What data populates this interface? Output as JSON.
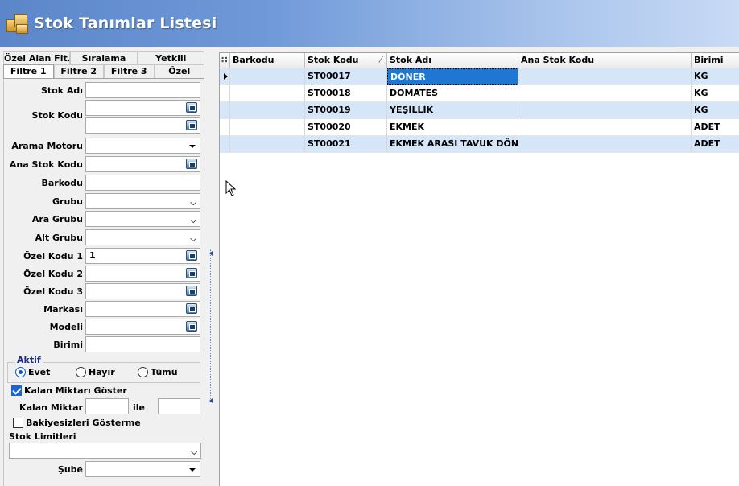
{
  "window": {
    "title": "Stok Tanımlar Listesi"
  },
  "tabs": {
    "row1": [
      "Özel Alan Flt.",
      "Sıralama",
      "Yetkili"
    ],
    "row2": [
      "Filtre 1",
      "Filtre 2",
      "Filtre 3",
      "Özel"
    ],
    "active": "Filtre 1"
  },
  "filter": {
    "labels": {
      "stok_adi": "Stok Adı",
      "stok_kodu": "Stok Kodu",
      "arama_motoru": "Arama Motoru",
      "ana_stok_kodu": "Ana Stok Kodu",
      "barkodu": "Barkodu",
      "grubu": "Grubu",
      "ara_grubu": "Ara Grubu",
      "alt_grubu": "Alt Grubu",
      "ozel_kodu_1": "Özel Kodu 1",
      "ozel_kodu_2": "Özel Kodu 2",
      "ozel_kodu_3": "Özel Kodu 3",
      "markasi": "Markası",
      "modeli": "Modeli",
      "birimi": "Birimi",
      "kalan_miktar": "Kalan Miktar",
      "ile": "ile",
      "stok_limitleri": "Stok Limitleri",
      "sube": "Şube"
    },
    "values": {
      "ozel_kodu_1": "1"
    },
    "aktif": {
      "title": "Aktif",
      "options": [
        "Evet",
        "Hayır",
        "Tümü"
      ],
      "selected": "Evet"
    },
    "checkboxes": {
      "kalan_miktari_goster": {
        "label": "Kalan Miktarı Göster",
        "checked": true
      },
      "bakiyesizleri_gosterme": {
        "label": "Bakiyesizleri Gösterme",
        "checked": false
      }
    }
  },
  "grid": {
    "columns": [
      "Barkodu",
      "Stok Kodu",
      "Stok Adı",
      "Ana Stok Kodu",
      "Birimi"
    ],
    "rows": [
      {
        "barkodu": "",
        "stok_kodu": "ST00017",
        "stok_adi": "DÖNER",
        "ana_stok_kodu": "",
        "birimi": "KG"
      },
      {
        "barkodu": "",
        "stok_kodu": "ST00018",
        "stok_adi": "DOMATES",
        "ana_stok_kodu": "",
        "birimi": "KG"
      },
      {
        "barkodu": "",
        "stok_kodu": "ST00019",
        "stok_adi": "YEŞİLLİK",
        "ana_stok_kodu": "",
        "birimi": "KG"
      },
      {
        "barkodu": "",
        "stok_kodu": "ST00020",
        "stok_adi": "EKMEK",
        "ana_stok_kodu": "",
        "birimi": "ADET"
      },
      {
        "barkodu": "",
        "stok_kodu": "ST00021",
        "stok_adi": "EKMEK ARASI TAVUK DÖNER",
        "ana_stok_kodu": "",
        "birimi": "ADET"
      }
    ],
    "selected_row": 0
  },
  "colors": {
    "title_gradient_start": "#5b86c9",
    "title_gradient_end": "#c9dbf5",
    "row_alt": "#d6e6f9",
    "selection": "#1e78d2",
    "group_title": "#1a2b8f"
  },
  "icons": [
    "app-boxes-icon",
    "picker-icon",
    "dropdown-arrow-icon",
    "row-indicator-icon",
    "sort-icon",
    "splitter-arrow-icon",
    "mouse-cursor-icon"
  ]
}
